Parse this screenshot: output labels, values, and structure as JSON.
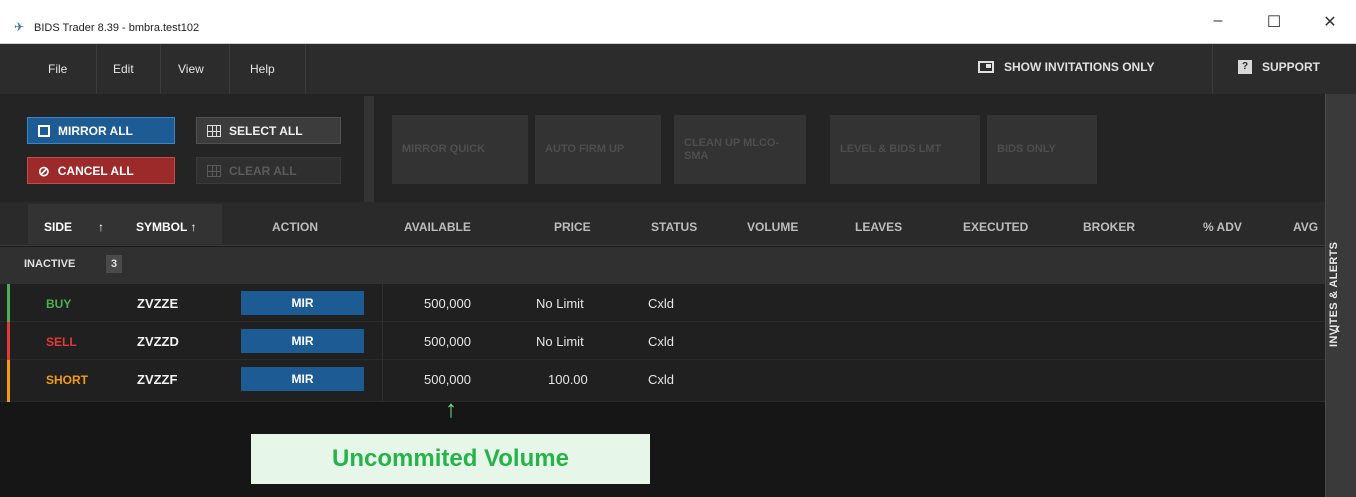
{
  "window": {
    "title": "BIDS Trader 8.39 - bmbra.test102",
    "minimize": "–",
    "maximize": "☐",
    "close": "✕"
  },
  "menu": {
    "items": [
      "File",
      "Edit",
      "View",
      "Help"
    ],
    "show_invitations": "SHOW INVITATIONS ONLY",
    "support": "SUPPORT"
  },
  "toolbar": {
    "mirror_all": "MIRROR ALL",
    "select_all": "SELECT ALL",
    "cancel_all": "CANCEL ALL",
    "clear_all": "CLEAR ALL",
    "disabled_buttons": [
      "MIRROR QUICK",
      "AUTO FIRM UP",
      "CLEAN UP MLCO-SMA",
      "LEVEL & BIDS LMT",
      "BIDS ONLY"
    ]
  },
  "columns": {
    "side": "SIDE",
    "side_sort": "↑",
    "symbol": "SYMBOL ↑",
    "action": "ACTION",
    "available": "AVAILABLE",
    "price": "PRICE",
    "status": "STATUS",
    "volume": "VOLUME",
    "leaves": "LEAVES",
    "executed": "EXECUTED",
    "broker": "BROKER",
    "pct_adv": "% ADV",
    "avg": "AVG"
  },
  "group": {
    "label": "INACTIVE",
    "count": "3"
  },
  "rows": [
    {
      "side": "BUY",
      "symbol": "ZVZZE",
      "action": "MIR",
      "available": "500,000",
      "price": "No Limit",
      "status": "Cxld",
      "color": "#4caf50"
    },
    {
      "side": "SELL",
      "symbol": "ZVZZD",
      "action": "MIR",
      "available": "500,000",
      "price": "No Limit",
      "status": "Cxld",
      "color": "#e53935"
    },
    {
      "side": "SHORT",
      "symbol": "ZVZZF",
      "action": "MIR",
      "available": "500,000",
      "price": "100.00",
      "status": "Cxld",
      "color": "#f39c12"
    }
  ],
  "side_panel": {
    "label": "INVITES & ALERTS",
    "chevron": "‹"
  },
  "annotation": {
    "arrow": "↑",
    "text": "Uncommited Volume"
  }
}
